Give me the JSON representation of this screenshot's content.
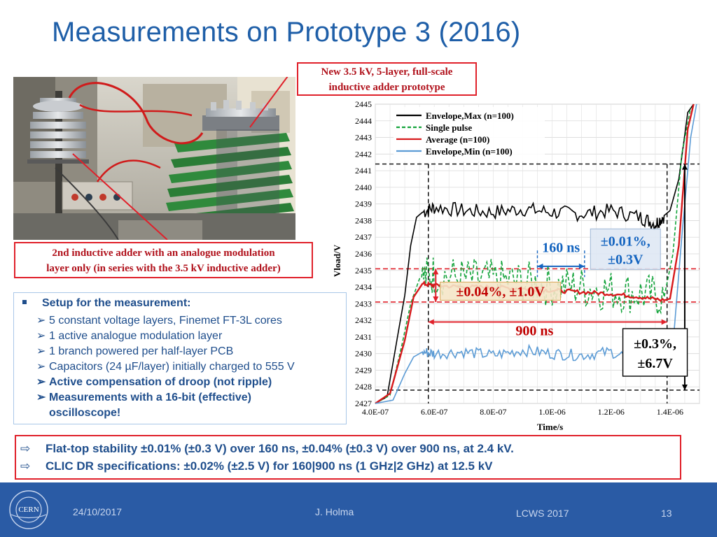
{
  "slide": {
    "title": "Measurements on Prototype 3 (2016)",
    "callout_new": {
      "line1": "New 3.5 kV, 5-layer, full-scale",
      "line2": "inductive adder prototype"
    },
    "callout_2nd": {
      "line1": "2nd inductive adder with an analogue modulation",
      "line2": "layer only (in series with the 3.5 kV inductive adder)"
    }
  },
  "setup": {
    "heading": "Setup for the measurement:",
    "items": [
      {
        "text": "5 constant voltage layers, Finemet FT-3L cores",
        "bold": false
      },
      {
        "text": "1 active analogue modulation layer",
        "bold": false
      },
      {
        "text": "1 branch powered  per half-layer PCB",
        "bold": false
      },
      {
        "text": "Capacitors (24 µF/layer) initially charged to 555 V",
        "bold": false
      },
      {
        "text": "Active compensation of droop (not ripple)",
        "bold": true
      },
      {
        "text": "Measurements with a 16-bit (effective)",
        "bold": true
      },
      {
        "text": "oscilloscope!",
        "bold": true
      }
    ],
    "arrow_glyph": "➢"
  },
  "chart_data": {
    "type": "line",
    "xlabel": "Time/s",
    "ylabel": "Vload/V",
    "xlim": [
      4e-07,
      1.5e-06
    ],
    "ylim": [
      2427,
      2445
    ],
    "x_ticks": [
      "4.0E-07",
      "6.0E-07",
      "8.0E-07",
      "1.0E-06",
      "1.2E-06",
      "1.4E-06"
    ],
    "y_ticks": [
      2427,
      2428,
      2429,
      2430,
      2431,
      2432,
      2433,
      2434,
      2435,
      2436,
      2437,
      2438,
      2439,
      2440,
      2441,
      2442,
      2443,
      2444,
      2445
    ],
    "grid": true,
    "legend_position": "top-left",
    "series": [
      {
        "name": "Envelope,Max (n=100)",
        "color": "#000000",
        "style": "solid",
        "x": [
          4e-07,
          4.4e-07,
          4.8e-07,
          5e-07,
          5.2e-07,
          5.4e-07,
          5.6e-07,
          6e-07,
          7e-07,
          8e-07,
          9e-07,
          1e-06,
          1.1e-06,
          1.2e-06,
          1.3e-06,
          1.35e-06,
          1.38e-06,
          1.4e-06,
          1.43e-06,
          1.46e-06,
          1.48e-06
        ],
        "y": [
          2427,
          2427.4,
          2431.5,
          2433.5,
          2436.5,
          2438.2,
          2438.5,
          2438.8,
          2438.6,
          2438.5,
          2438.7,
          2438.5,
          2438.4,
          2438.6,
          2438.2,
          2437.8,
          2438.3,
          2438.6,
          2440.5,
          2444.5,
          2445
        ]
      },
      {
        "name": "Single pulse",
        "color": "#12a33a",
        "style": "dashed",
        "x": [
          4e-07,
          4.5e-07,
          4.9e-07,
          5.2e-07,
          5.5e-07,
          6e-07,
          7e-07,
          8e-07,
          9e-07,
          1e-06,
          1.1e-06,
          1.2e-06,
          1.3e-06,
          1.38e-06,
          1.41e-06,
          1.44e-06,
          1.47e-06
        ],
        "y": [
          2427,
          2427.5,
          2430.5,
          2433,
          2434.5,
          2434.8,
          2434.5,
          2434.4,
          2434.3,
          2434.1,
          2434.0,
          2433.8,
          2433.6,
          2433.4,
          2436,
          2442,
          2444.8
        ]
      },
      {
        "name": "Average (n=100)",
        "color": "#d7191c",
        "style": "solid",
        "x": [
          4e-07,
          4.5e-07,
          5e-07,
          5.3e-07,
          5.6e-07,
          6e-07,
          7e-07,
          8e-07,
          9e-07,
          1e-06,
          1.1e-06,
          1.2e-06,
          1.3e-06,
          1.38e-06,
          1.4e-06,
          1.43e-06,
          1.46e-06,
          1.48e-06
        ],
        "y": [
          2427,
          2427.6,
          2430.8,
          2433.4,
          2434.2,
          2434.1,
          2434.0,
          2434.0,
          2433.9,
          2433.8,
          2433.7,
          2433.6,
          2433.4,
          2433.2,
          2433.3,
          2436.5,
          2443.5,
          2445
        ]
      },
      {
        "name": "Envelope,Min (n=100)",
        "color": "#5b9bd5",
        "style": "solid",
        "x": [
          4e-07,
          4.6e-07,
          5e-07,
          5.3e-07,
          5.6e-07,
          6e-07,
          7e-07,
          8e-07,
          9e-07,
          1e-06,
          1.1e-06,
          1.2e-06,
          1.3e-06,
          1.38e-06,
          1.41e-06,
          1.44e-06,
          1.47e-06,
          1.49e-06
        ],
        "y": [
          2427,
          2427.2,
          2428.8,
          2429.8,
          2430.1,
          2430.0,
          2430.1,
          2429.9,
          2430.2,
          2430.0,
          2429.9,
          2430.1,
          2429.6,
          2429.3,
          2430.5,
          2437,
          2443,
          2445
        ]
      }
    ],
    "reference_lines": {
      "black_dashed_y": [
        2441.4,
        2427.8
      ],
      "red_dashed_y": [
        2435.1,
        2433.1
      ],
      "black_dashed_x": [
        5.8e-07,
        1.39e-06
      ],
      "blue_dashed_x": [
        9.5e-07,
        1.11e-06
      ]
    },
    "annotations": [
      {
        "text": "160 ns",
        "color": "#1565c0",
        "span_x": [
          9.5e-07,
          1.11e-06
        ],
        "y": 2435.3
      },
      {
        "text": "±0.01%,",
        "color": "#1565c0",
        "boxed": true
      },
      {
        "text": "±0.3V",
        "color": "#1565c0",
        "boxed": true
      },
      {
        "text": "±0.04%, ±1.0V",
        "color": "#c00000",
        "boxed": true
      },
      {
        "text": "900 ns",
        "color": "#c00000",
        "span_x": [
          5.8e-07,
          1.39e-06
        ],
        "y": 2432.0
      },
      {
        "text": "±0.3%,",
        "color": "#000000",
        "boxed": true
      },
      {
        "text": "±6.7V",
        "color": "#000000",
        "boxed": true
      }
    ]
  },
  "summary": {
    "mark_glyph": "⇨",
    "line1": "Flat-top stability ±0.01% (±0.3 V) over 160 ns, ±0.04% (±0.3 V) over 900 ns, at 2.4 kV.",
    "line2": "CLIC DR specifications: ±0.02% (±2.5 V) for 160|900 ns (1 GHz|2 GHz) at 12.5 kV"
  },
  "footer": {
    "logo_text": "CERN",
    "date": "24/10/2017",
    "author": "J. Holma",
    "event": "LCWS 2017",
    "page": "13"
  },
  "colors": {
    "title": "#1f5fa8",
    "accent_red": "#e0202a",
    "text_blue": "#1f4e8c",
    "footer_bg": "#2a5ba5"
  }
}
